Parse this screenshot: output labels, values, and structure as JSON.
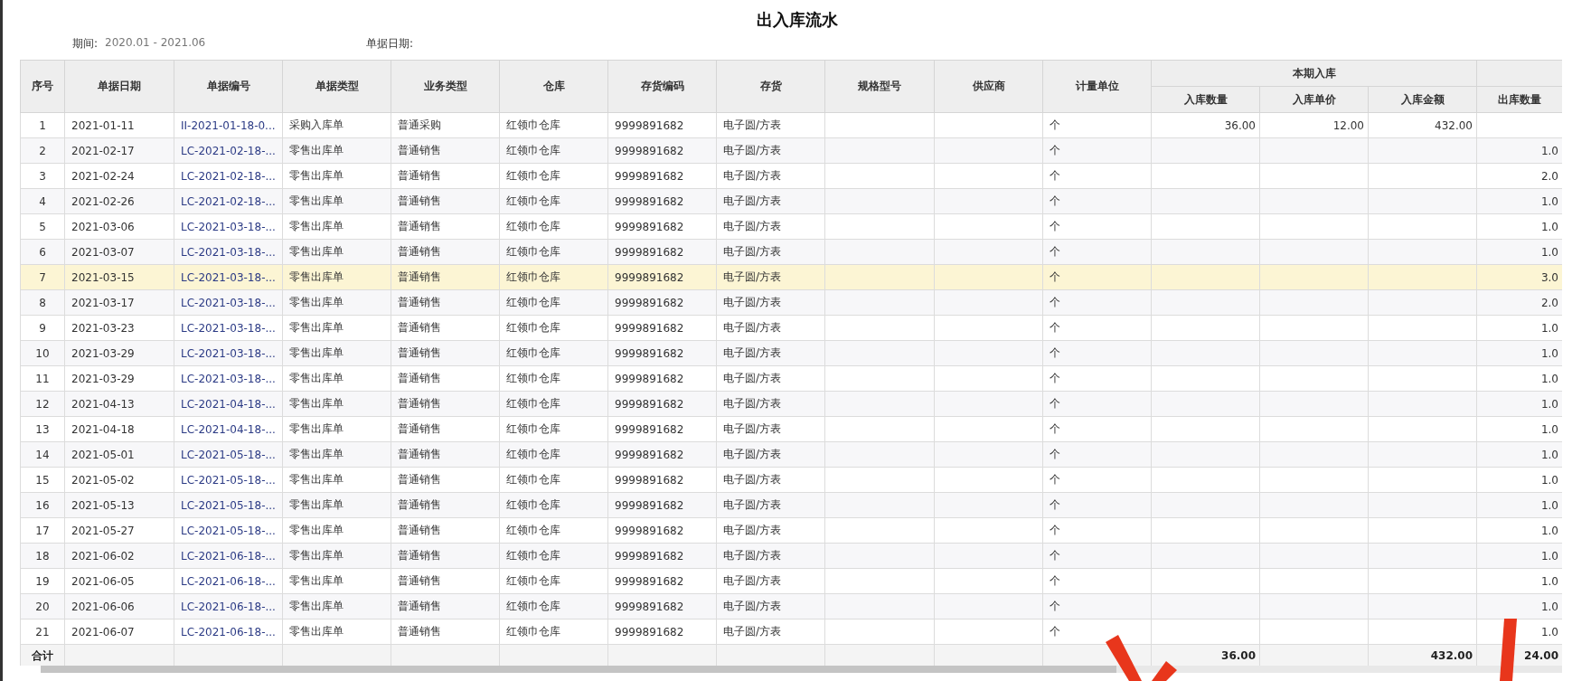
{
  "title": "出入库流水",
  "filters": [
    {
      "label": "期间:",
      "value": "2020.01 - 2021.06"
    },
    {
      "label": "单据日期:"
    }
  ],
  "columns": [
    {
      "label": "序号"
    },
    {
      "label": "单据日期"
    },
    {
      "label": "单据编号"
    },
    {
      "label": "单据类型"
    },
    {
      "label": "业务类型"
    },
    {
      "label": "仓库"
    },
    {
      "label": "存货编码"
    },
    {
      "label": "存货"
    },
    {
      "label": "规格型号"
    },
    {
      "label": "供应商"
    },
    {
      "label": "计量单位"
    },
    {
      "label": "本期入库",
      "children": [
        {
          "label": "入库数量"
        },
        {
          "label": "入库单价"
        },
        {
          "label": "入库金额"
        }
      ]
    },
    {
      "children": [
        {
          "label": "出库数量"
        }
      ]
    }
  ],
  "rows": [
    {
      "selected": false,
      "no": "1",
      "date": "2021-01-11",
      "number": "II-2021-01-18-0...",
      "doc_type": "采购入库单",
      "biz_type": "普通采购",
      "warehouse": "红领巾仓库",
      "code": "9999891682",
      "item": "电子圆/方表",
      "unit": "个",
      "in_qty": "36.00",
      "in_price": "12.00",
      "in_amount": "432.00"
    },
    {
      "selected": false,
      "no": "2",
      "date": "2021-02-17",
      "number": "LC-2021-02-18-...",
      "doc_type": "零售出库单",
      "biz_type": "普通销售",
      "warehouse": "红领巾仓库",
      "code": "9999891682",
      "item": "电子圆/方表",
      "unit": "个",
      "out_qty": "1.0"
    },
    {
      "selected": false,
      "no": "3",
      "date": "2021-02-24",
      "number": "LC-2021-02-18-...",
      "doc_type": "零售出库单",
      "biz_type": "普通销售",
      "warehouse": "红领巾仓库",
      "code": "9999891682",
      "item": "电子圆/方表",
      "unit": "个",
      "out_qty": "2.0"
    },
    {
      "selected": false,
      "no": "4",
      "date": "2021-02-26",
      "number": "LC-2021-02-18-...",
      "doc_type": "零售出库单",
      "biz_type": "普通销售",
      "warehouse": "红领巾仓库",
      "code": "9999891682",
      "item": "电子圆/方表",
      "unit": "个",
      "out_qty": "1.0"
    },
    {
      "selected": false,
      "no": "5",
      "date": "2021-03-06",
      "number": "LC-2021-03-18-...",
      "doc_type": "零售出库单",
      "biz_type": "普通销售",
      "warehouse": "红领巾仓库",
      "code": "9999891682",
      "item": "电子圆/方表",
      "unit": "个",
      "out_qty": "1.0"
    },
    {
      "selected": false,
      "no": "6",
      "date": "2021-03-07",
      "number": "LC-2021-03-18-...",
      "doc_type": "零售出库单",
      "biz_type": "普通销售",
      "warehouse": "红领巾仓库",
      "code": "9999891682",
      "item": "电子圆/方表",
      "unit": "个",
      "out_qty": "1.0"
    },
    {
      "selected": true,
      "no": "7",
      "date": "2021-03-15",
      "number": "LC-2021-03-18-...",
      "doc_type": "零售出库单",
      "biz_type": "普通销售",
      "warehouse": "红领巾仓库",
      "code": "9999891682",
      "item": "电子圆/方表",
      "unit": "个",
      "out_qty": "3.0"
    },
    {
      "selected": false,
      "no": "8",
      "date": "2021-03-17",
      "number": "LC-2021-03-18-...",
      "doc_type": "零售出库单",
      "biz_type": "普通销售",
      "warehouse": "红领巾仓库",
      "code": "9999891682",
      "item": "电子圆/方表",
      "unit": "个",
      "out_qty": "2.0"
    },
    {
      "selected": false,
      "no": "9",
      "date": "2021-03-23",
      "number": "LC-2021-03-18-...",
      "doc_type": "零售出库单",
      "biz_type": "普通销售",
      "warehouse": "红领巾仓库",
      "code": "9999891682",
      "item": "电子圆/方表",
      "unit": "个",
      "out_qty": "1.0"
    },
    {
      "selected": false,
      "no": "10",
      "date": "2021-03-29",
      "number": "LC-2021-03-18-...",
      "doc_type": "零售出库单",
      "biz_type": "普通销售",
      "warehouse": "红领巾仓库",
      "code": "9999891682",
      "item": "电子圆/方表",
      "unit": "个",
      "out_qty": "1.0"
    },
    {
      "selected": false,
      "no": "11",
      "date": "2021-03-29",
      "number": "LC-2021-03-18-...",
      "doc_type": "零售出库单",
      "biz_type": "普通销售",
      "warehouse": "红领巾仓库",
      "code": "9999891682",
      "item": "电子圆/方表",
      "unit": "个",
      "out_qty": "1.0"
    },
    {
      "selected": false,
      "no": "12",
      "date": "2021-04-13",
      "number": "LC-2021-04-18-...",
      "doc_type": "零售出库单",
      "biz_type": "普通销售",
      "warehouse": "红领巾仓库",
      "code": "9999891682",
      "item": "电子圆/方表",
      "unit": "个",
      "out_qty": "1.0"
    },
    {
      "selected": false,
      "no": "13",
      "date": "2021-04-18",
      "number": "LC-2021-04-18-...",
      "doc_type": "零售出库单",
      "biz_type": "普通销售",
      "warehouse": "红领巾仓库",
      "code": "9999891682",
      "item": "电子圆/方表",
      "unit": "个",
      "out_qty": "1.0"
    },
    {
      "selected": false,
      "no": "14",
      "date": "2021-05-01",
      "number": "LC-2021-05-18-...",
      "doc_type": "零售出库单",
      "biz_type": "普通销售",
      "warehouse": "红领巾仓库",
      "code": "9999891682",
      "item": "电子圆/方表",
      "unit": "个",
      "out_qty": "1.0"
    },
    {
      "selected": false,
      "no": "15",
      "date": "2021-05-02",
      "number": "LC-2021-05-18-...",
      "doc_type": "零售出库单",
      "biz_type": "普通销售",
      "warehouse": "红领巾仓库",
      "code": "9999891682",
      "item": "电子圆/方表",
      "unit": "个",
      "out_qty": "1.0"
    },
    {
      "selected": false,
      "no": "16",
      "date": "2021-05-13",
      "number": "LC-2021-05-18-...",
      "doc_type": "零售出库单",
      "biz_type": "普通销售",
      "warehouse": "红领巾仓库",
      "code": "9999891682",
      "item": "电子圆/方表",
      "unit": "个",
      "out_qty": "1.0"
    },
    {
      "selected": false,
      "no": "17",
      "date": "2021-05-27",
      "number": "LC-2021-05-18-...",
      "doc_type": "零售出库单",
      "biz_type": "普通销售",
      "warehouse": "红领巾仓库",
      "code": "9999891682",
      "item": "电子圆/方表",
      "unit": "个",
      "out_qty": "1.0"
    },
    {
      "selected": false,
      "no": "18",
      "date": "2021-06-02",
      "number": "LC-2021-06-18-...",
      "doc_type": "零售出库单",
      "biz_type": "普通销售",
      "warehouse": "红领巾仓库",
      "code": "9999891682",
      "item": "电子圆/方表",
      "unit": "个",
      "out_qty": "1.0"
    },
    {
      "selected": false,
      "no": "19",
      "date": "2021-06-05",
      "number": "LC-2021-06-18-...",
      "doc_type": "零售出库单",
      "biz_type": "普通销售",
      "warehouse": "红领巾仓库",
      "code": "9999891682",
      "item": "电子圆/方表",
      "unit": "个",
      "out_qty": "1.0"
    },
    {
      "selected": false,
      "no": "20",
      "date": "2021-06-06",
      "number": "LC-2021-06-18-...",
      "doc_type": "零售出库单",
      "biz_type": "普通销售",
      "warehouse": "红领巾仓库",
      "code": "9999891682",
      "item": "电子圆/方表",
      "unit": "个",
      "out_qty": "1.0"
    },
    {
      "selected": false,
      "no": "21",
      "date": "2021-06-07",
      "number": "LC-2021-06-18-...",
      "doc_type": "零售出库单",
      "biz_type": "普通销售",
      "warehouse": "红领巾仓库",
      "code": "9999891682",
      "item": "电子圆/方表",
      "unit": "个",
      "out_qty": "1.0"
    }
  ],
  "totals": {
    "label": "合计",
    "in_qty": "36.00",
    "in_amount": "432.00",
    "out_qty": "24.00"
  }
}
